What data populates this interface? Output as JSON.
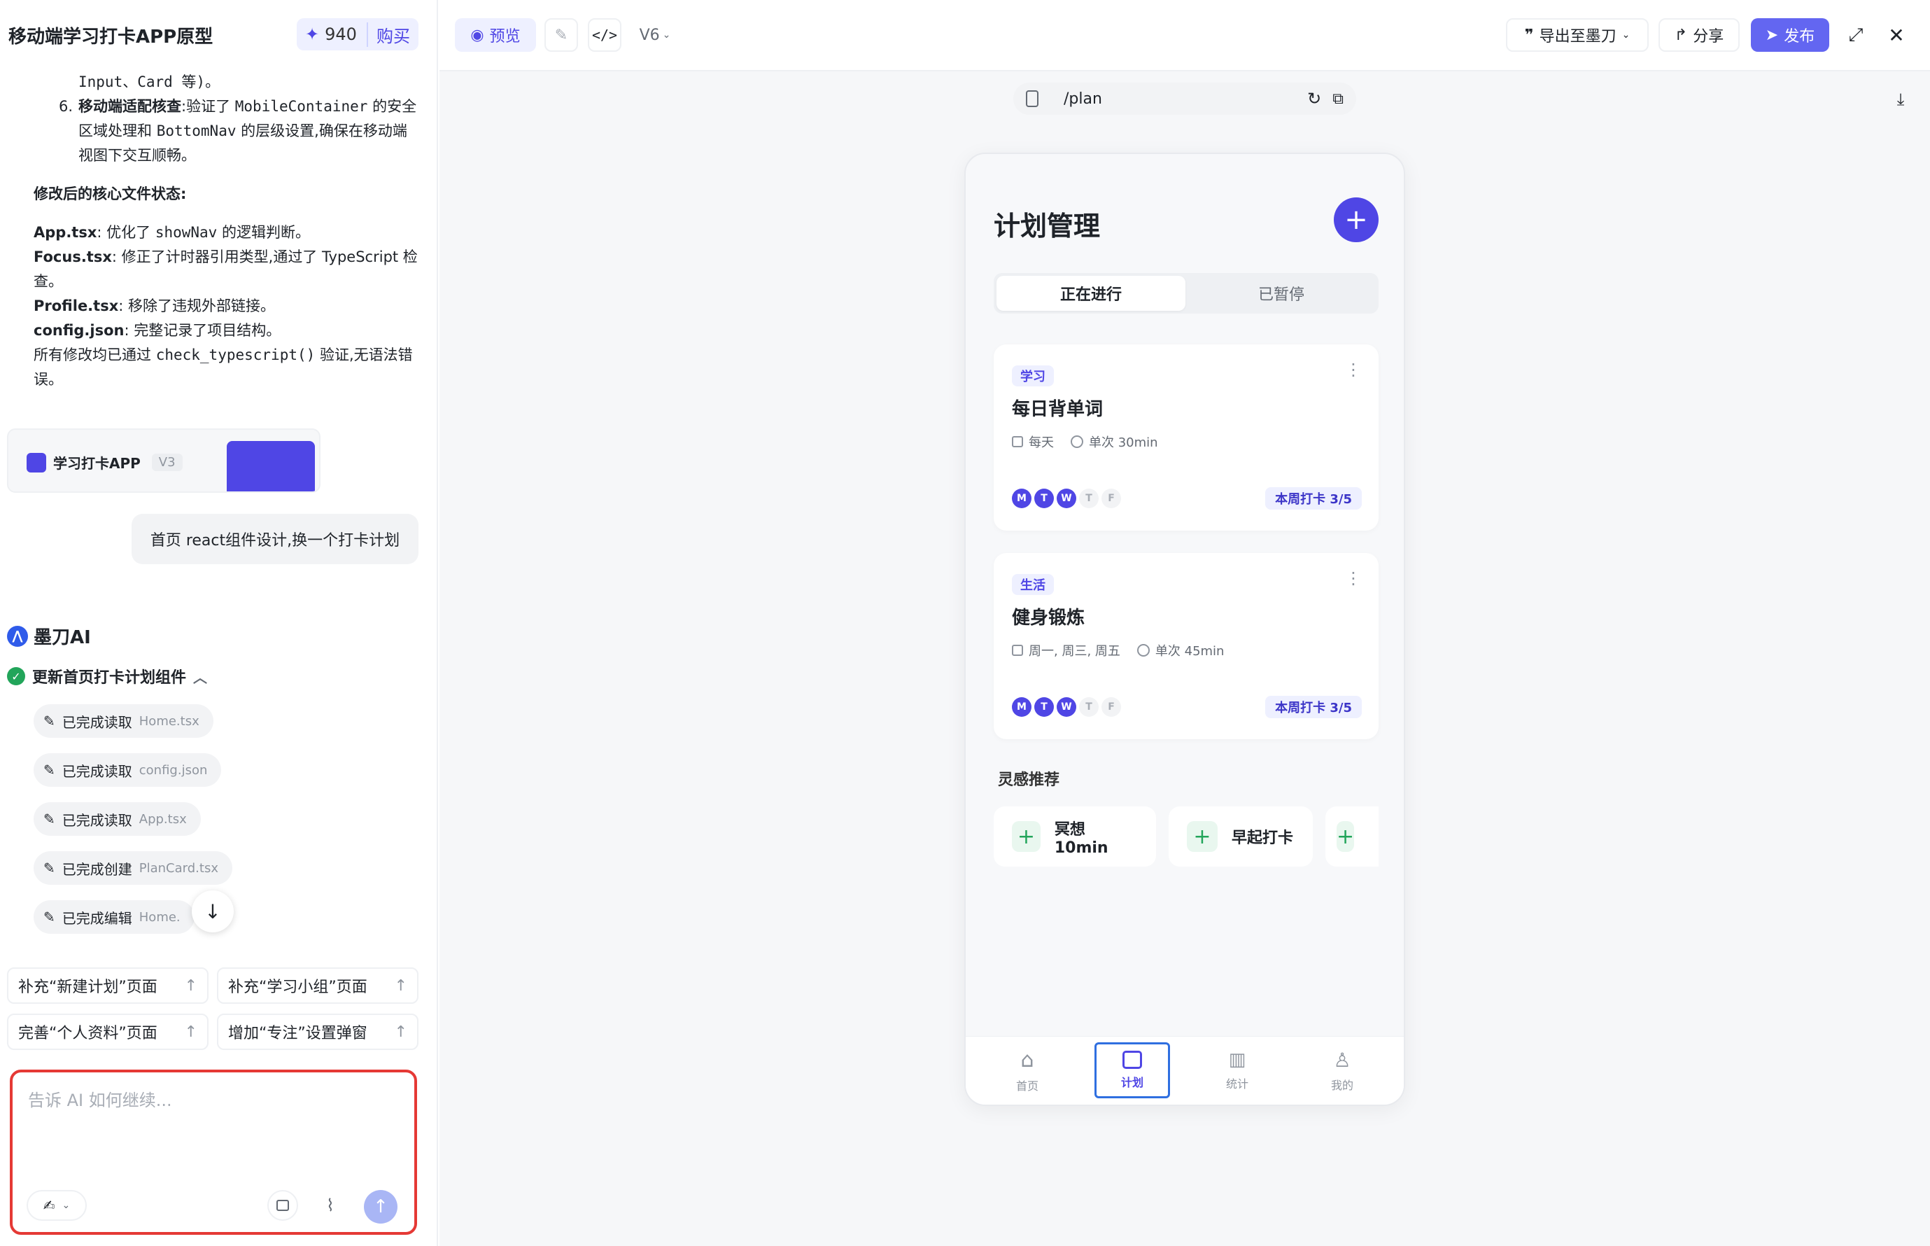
{
  "app": {
    "title": "移动端学习打卡APP原型",
    "credits": "940",
    "buy_label": "购买"
  },
  "topbar": {
    "preview_label": "预览",
    "version": "V6",
    "export_label": "导出至墨刀",
    "share_label": "分享",
    "publish_label": "发布"
  },
  "chat": {
    "line1": "Input、Card 等)。",
    "item6_num": "6.",
    "item6_bold": "移动端适配核查",
    "item6_a": ":验证了 ",
    "item6_code1": "MobileContainer",
    "item6_b": " 的安全区域处理和 ",
    "item6_code2": "BottomNav",
    "item6_c": " 的层级设置,确保在移动端视图下交互顺畅。",
    "state_heading": "修改后的核心文件状态:",
    "files": [
      {
        "name": "App.tsx",
        "pre": ": 优化了 ",
        "code": "showNav",
        "post": " 的逻辑判断。"
      },
      {
        "name": "Focus.tsx",
        "pre": ": 修正了计时器引用类型,通过了 TypeScript 检查。",
        "code": "",
        "post": ""
      },
      {
        "name": "Profile.tsx",
        "pre": ": 移除了违规外部链接。",
        "code": "",
        "post": ""
      },
      {
        "name": "config.json",
        "pre": ": 完整记录了项目结构。",
        "code": "",
        "post": ""
      }
    ],
    "summary_a": "所有修改均已通过 ",
    "summary_code": "check_typescript()",
    "summary_b": " 验证,无语法错误。",
    "card_title": "学习打卡APP",
    "card_version": "V3",
    "user_message": "首页 react组件设计,换一个打卡计划",
    "ai_name": "墨刀AI",
    "task_title": "更新首页打卡计划组件",
    "steps": [
      {
        "action": "已完成读取",
        "file": "Home.tsx"
      },
      {
        "action": "已完成读取",
        "file": "config.json"
      },
      {
        "action": "已完成读取",
        "file": "App.tsx"
      },
      {
        "action": "已完成创建",
        "file": "PlanCard.tsx"
      },
      {
        "action": "已完成编辑",
        "file": "Home."
      }
    ],
    "suggestions": [
      "补充“新建计划”页面",
      "补充“学习小组”页面",
      "完善“个人资料”页面",
      "增加“专注”设置弹窗"
    ],
    "input_placeholder": "告诉 AI 如何继续..."
  },
  "preview": {
    "url": "/plan",
    "page_title": "计划管理",
    "tabs": [
      "正在进行",
      "已暂停"
    ],
    "plans": [
      {
        "tag": "学习",
        "name": "每日背单词",
        "freq": "每天",
        "duration": "单次 30min",
        "days": [
          "M",
          "T",
          "W",
          "T",
          "F"
        ],
        "week": "本周打卡 3/5"
      },
      {
        "tag": "生活",
        "name": "健身锻炼",
        "freq": "周一, 周三, 周五",
        "duration": "单次 45min",
        "days": [
          "M",
          "T",
          "W",
          "T",
          "F"
        ],
        "week": "本周打卡 3/5"
      }
    ],
    "inspiration_title": "灵感推荐",
    "inspirations": [
      "冥想 10min",
      "早起打卡",
      ""
    ],
    "nav": [
      "首页",
      "计划",
      "统计",
      "我的"
    ]
  },
  "colors": {
    "accent": "#4f46e5",
    "success": "#22a55a",
    "danger": "#e53935"
  }
}
